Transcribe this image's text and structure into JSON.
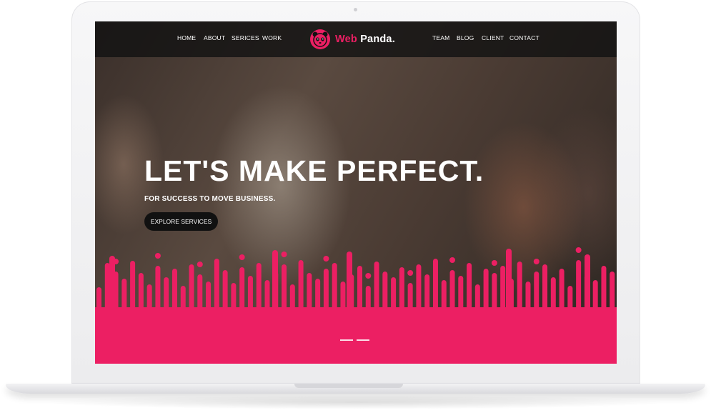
{
  "nav": {
    "left_links": [
      "HOME",
      "ABOUT",
      "SERICES",
      "WORK"
    ],
    "right_links": [
      "TEAM",
      "BLOG",
      "CLIENT",
      "CONTACT"
    ]
  },
  "logo": {
    "text_primary": "Web",
    "text_secondary": "Panda",
    "text_dot": ".",
    "icon": "panda-icon"
  },
  "hero": {
    "title": "LET'S MAKE PERFECT.",
    "subtitle": "FOR SUCCESS TO MOVE BUSINESS.",
    "button_label": "EXPLORE SERVICES"
  },
  "slider": {
    "dot_count": 2
  },
  "colors": {
    "accent": "#ec1f63",
    "nav_bg": "#121212",
    "button_bg": "#111111",
    "text": "#ffffff"
  }
}
